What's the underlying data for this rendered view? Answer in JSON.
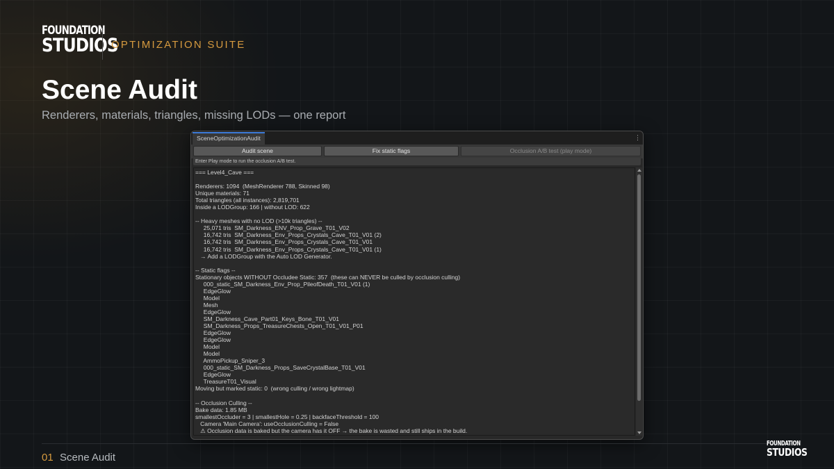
{
  "brand": {
    "logo_line1": "FOUNDATION",
    "logo_line2": "STUDIOS",
    "suite": "OPTIMIZATION SUITE"
  },
  "page": {
    "title": "Scene Audit",
    "subtitle": "Renderers, materials, triangles, missing LODs — one report"
  },
  "editor": {
    "tab_title": "SceneOptimizationAudit",
    "menu_icon": "kebab-menu-icon",
    "buttons": {
      "audit_scene": "Audit scene",
      "fix_static_flags": "Fix static flags",
      "occlusion_test": "Occlusion A/B test (play mode)"
    },
    "help_text": "Enter Play mode to run the occlusion A/B test.",
    "report": [
      "=== Level4_Cave ===",
      "",
      "Renderers: 1094  (MeshRenderer 788, Skinned 98)",
      "Unique materials: 71",
      "Total triangles (all instances): 2,819,701",
      "Inside a LODGroup: 166 | without LOD: 622",
      "",
      "-- Heavy meshes with no LOD (>10k triangles) --",
      "     25,071 tris  SM_Darkness_ENV_Prop_Grave_T01_V02",
      "     16,742 tris  SM_Darkness_Env_Props_Crystals_Cave_T01_V01 (2)",
      "     16,742 tris  SM_Darkness_Env_Props_Crystals_Cave_T01_V01",
      "     16,742 tris  SM_Darkness_Env_Props_Crystals_Cave_T01_V01 (1)",
      "   → Add a LODGroup with the Auto LOD Generator.",
      "",
      "-- Static flags --",
      "Stationary objects WITHOUT Occludee Static: 357  (these can NEVER be culled by occlusion culling)",
      "     000_static_SM_Darkness_Env_Prop_PileofDeath_T01_V01 (1)",
      "     EdgeGlow",
      "     Model",
      "     Mesh",
      "     EdgeGlow",
      "     SM_Darkness_Cave_Part01_Keys_Bone_T01_V01",
      "     SM_Darkness_Props_TreasureChests_Open_T01_V01_P01",
      "     EdgeGlow",
      "     EdgeGlow",
      "     Model",
      "     Model",
      "     AmmoPickup_Sniper_3",
      "     000_static_SM_Darkness_Props_SaveCrystalBase_T01_V01",
      "     EdgeGlow",
      "     TreasureT01_Visual",
      "Moving but marked static: 0  (wrong culling / wrong lightmap)",
      "",
      "-- Occlusion Culling --",
      "Bake data: 1.85 MB",
      "smallestOccluder = 3 | smallestHole = 0.25 | backfaceThreshold = 100",
      "   Camera 'Main Camera': useOcclusionCulling = False",
      "   ⚠ Occlusion data is baked but the camera has it OFF → the bake is wasted and still ships in the build."
    ]
  },
  "footer": {
    "number": "01",
    "label": "Scene Audit",
    "logo_line1": "FOUNDATION",
    "logo_line2": "STUDIOS"
  }
}
